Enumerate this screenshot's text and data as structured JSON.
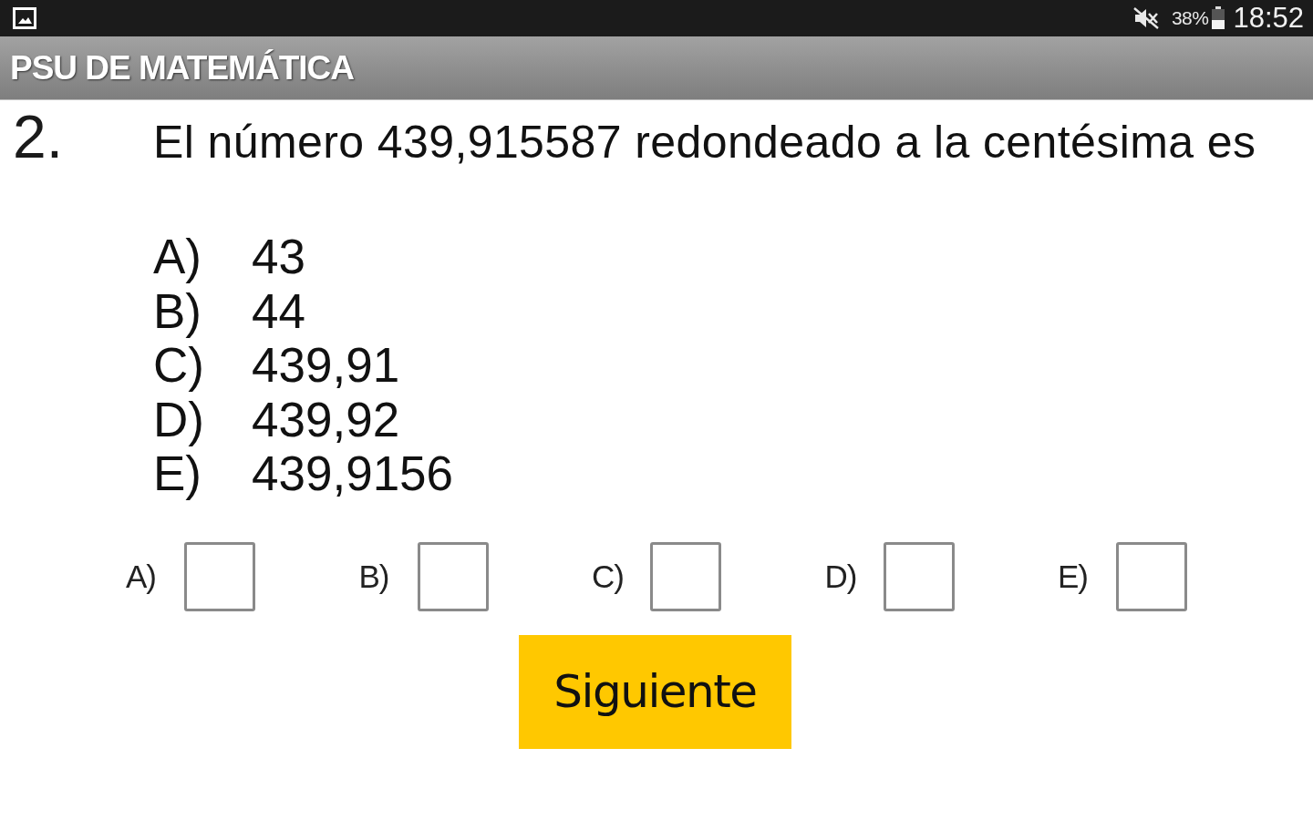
{
  "status_bar": {
    "battery": "38%",
    "time": "18:52"
  },
  "app_bar": {
    "title": "PSU DE MATEMÁTICA"
  },
  "question": {
    "number": "2.",
    "text": "El número 439,915587 redondeado a la centésima es",
    "options": [
      {
        "letter": "A)",
        "value": "43"
      },
      {
        "letter": "B)",
        "value": "44"
      },
      {
        "letter": "C)",
        "value": "439,91"
      },
      {
        "letter": "D)",
        "value": "439,92"
      },
      {
        "letter": "E)",
        "value": "439,9156"
      }
    ]
  },
  "answers": [
    {
      "label": "A)",
      "checked": false
    },
    {
      "label": "B)",
      "checked": false
    },
    {
      "label": "C)",
      "checked": false
    },
    {
      "label": "D)",
      "checked": false
    },
    {
      "label": "E)",
      "checked": false
    }
  ],
  "next_button": {
    "label": "Siguiente"
  }
}
